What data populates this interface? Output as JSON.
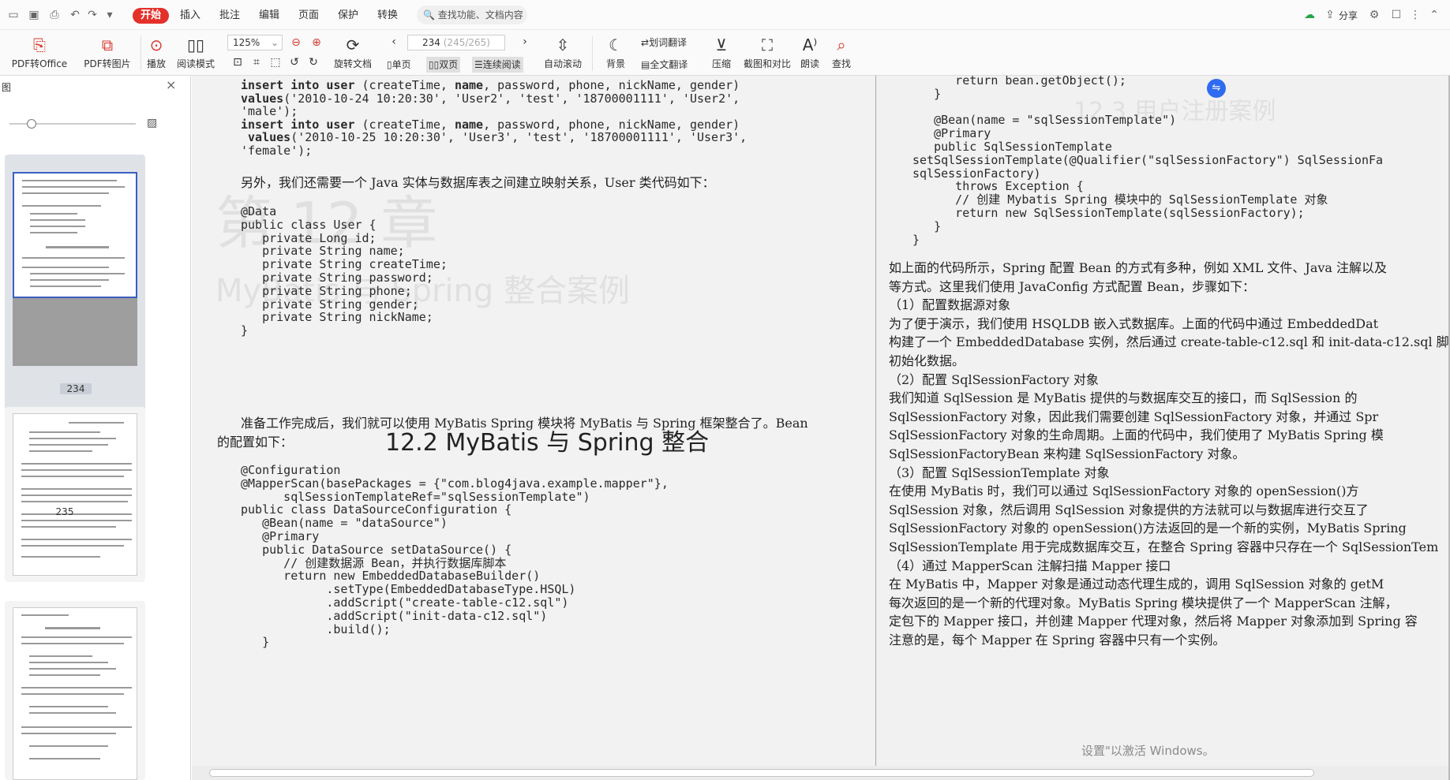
{
  "menu": {
    "tabs": [
      "开始",
      "插入",
      "批注",
      "编辑",
      "页面",
      "保护",
      "转换"
    ],
    "active_tab": "开始",
    "search_placeholder": "查找功能、文档内容",
    "share_label": "分享"
  },
  "toolbar": {
    "pdf_to_office": "PDF转Office",
    "pdf_to_image": "PDF转图片",
    "play": "播放",
    "reading_mode": "阅读模式",
    "zoom": "125%",
    "rotate_doc": "旋转文档",
    "page_current": "234",
    "page_info": "(245/265)",
    "single_page": "单页",
    "double_page": "双页",
    "continuous": "连续阅读",
    "auto_scroll": "自动滚动",
    "background": "背景",
    "word_translate": "划词翻译",
    "full_translate": "全文翻译",
    "compress": "压缩",
    "screenshot_compare": "截图和对比",
    "read_aloud": "朗读",
    "find": "查找"
  },
  "sidebar": {
    "title": "图",
    "thumbs": [
      {
        "page_label": "234",
        "selected": true
      },
      {
        "page_label": "235",
        "selected": false
      },
      {
        "page_label": "",
        "selected": false
      }
    ]
  },
  "left_page": {
    "code_top": [
      [
        {
          "b": "insert into user"
        },
        {
          "t": " (createTime, "
        },
        {
          "b": "name"
        },
        {
          "t": ", password, phone, nickName, gender)"
        }
      ],
      [
        {
          "b": "values"
        },
        {
          "t": "('2010-10-24 10:20:30', 'User2', 'test', '18700001111', 'User2',"
        }
      ],
      [
        {
          "t": "'male');"
        }
      ],
      [
        {
          "b": "insert into user"
        },
        {
          "t": " (createTime, "
        },
        {
          "b": "name"
        },
        {
          "t": ", password, phone, nickName, gender)"
        }
      ],
      [
        {
          "b": " values"
        },
        {
          "t": "('2010-10-25 10:20:30', 'User3', 'test', '18700001111', 'User3',"
        }
      ],
      [
        {
          "t": "'female');"
        }
      ]
    ],
    "para1": "另外，我们还需要一个 Java 实体与数据库表之间建立映射关系，User 类代码如下：",
    "code_class": [
      "@Data",
      "public class User {",
      "   private Long id;",
      "   private String name;",
      "   private String createTime;",
      "   private String password;",
      "   private String phone;",
      "   private String gender;",
      "   private String nickName;",
      "}"
    ],
    "section_title": "12.2   MyBatis 与 Spring 整合",
    "para2_line1": "准备工作完成后，我们就可以使用 MyBatis Spring 模块将 MyBatis 与 Spring 框架整合了。Bean",
    "para2_line2": "的配置如下：",
    "code_config": [
      "@Configuration",
      "@MapperScan(basePackages = {\"com.blog4java.example.mapper\"},",
      "      sqlSessionTemplateRef=\"sqlSessionTemplate\")",
      "public class DataSourceConfiguration {",
      "   @Bean(name = \"dataSource\")",
      "   @Primary",
      "   public DataSource setDataSource() {",
      "      // 创建数据源 Bean，并执行数据库脚本",
      "      return new EmbeddedDatabaseBuilder()",
      "            .setType(EmbeddedDatabaseType.HSQL)",
      "            .addScript(\"create-table-c12.sql\")",
      "            .addScript(\"init-data-c12.sql\")",
      "            .build();",
      "   }"
    ]
  },
  "right_page": {
    "code": [
      "      return bean.getObject();",
      "   }",
      "",
      "   @Bean(name = \"sqlSessionTemplate\")",
      "   @Primary",
      "   public SqlSessionTemplate",
      "setSqlSessionTemplate(@Qualifier(\"sqlSessionFactory\") SqlSessionFa",
      "sqlSessionFactory)",
      "      throws Exception {",
      "      // 创建 Mybatis Spring 模块中的 SqlSessionTemplate 对象",
      "      return new SqlSessionTemplate(sqlSessionFactory);",
      "   }",
      "}"
    ],
    "text_lines": [
      "   如上面的代码所示，Spring 配置 Bean 的方式有多种，例如 XML 文件、Java 注解以及",
      "等方式。这里我们使用 JavaConfig 方式配置 Bean，步骤如下：",
      "  （1）配置数据源对象",
      "   为了便于演示，我们使用 HSQLDB 嵌入式数据库。上面的代码中通过 EmbeddedDat",
      "构建了一个 EmbeddedDatabase 实例，然后通过 create-table-c12.sql 和 init-data-c12.sql 脚",
      "初始化数据。",
      "  （2）配置 SqlSessionFactory 对象",
      "   我们知道 SqlSession 是 MyBatis 提供的与数据库交互的接口，而 SqlSession 的",
      "SqlSessionFactory 对象，因此我们需要创建 SqlSessionFactory 对象，并通过 Spr",
      "SqlSessionFactory 对象的生命周期。上面的代码中，我们使用了 MyBatis Spring 模",
      "SqlSessionFactoryBean 来构建 SqlSessionFactory 对象。",
      "  （3）配置 SqlSessionTemplate 对象",
      "   在使用 MyBatis 时，我们可以通过 SqlSessionFactory 对象的 openSession()方",
      "SqlSession 对象，然后调用 SqlSession 对象提供的方法就可以与数据库进行交互了",
      "SqlSessionFactory 对象的 openSession()方法返回的是一个新的实例，MyBatis Spring",
      "SqlSessionTemplate 用于完成数据库交互，在整合 Spring 容器中只存在一个 SqlSessionTem",
      "  （4）通过 MapperScan 注解扫描 Mapper 接口",
      "   在 MyBatis 中，Mapper 对象是通过动态代理生成的，调用 SqlSession 对象的 getM",
      "每次返回的是一个新的代理对象。MyBatis Spring 模块提供了一个 MapperScan 注解，",
      "定包下的 Mapper 接口，并创建 Mapper 代理对象，然后将 Mapper 对象添加到 Spring 容",
      "注意的是，每个 Mapper 在 Spring 容器中只有一个实例。"
    ]
  },
  "watermark": "设置\"以激活 Windows。"
}
